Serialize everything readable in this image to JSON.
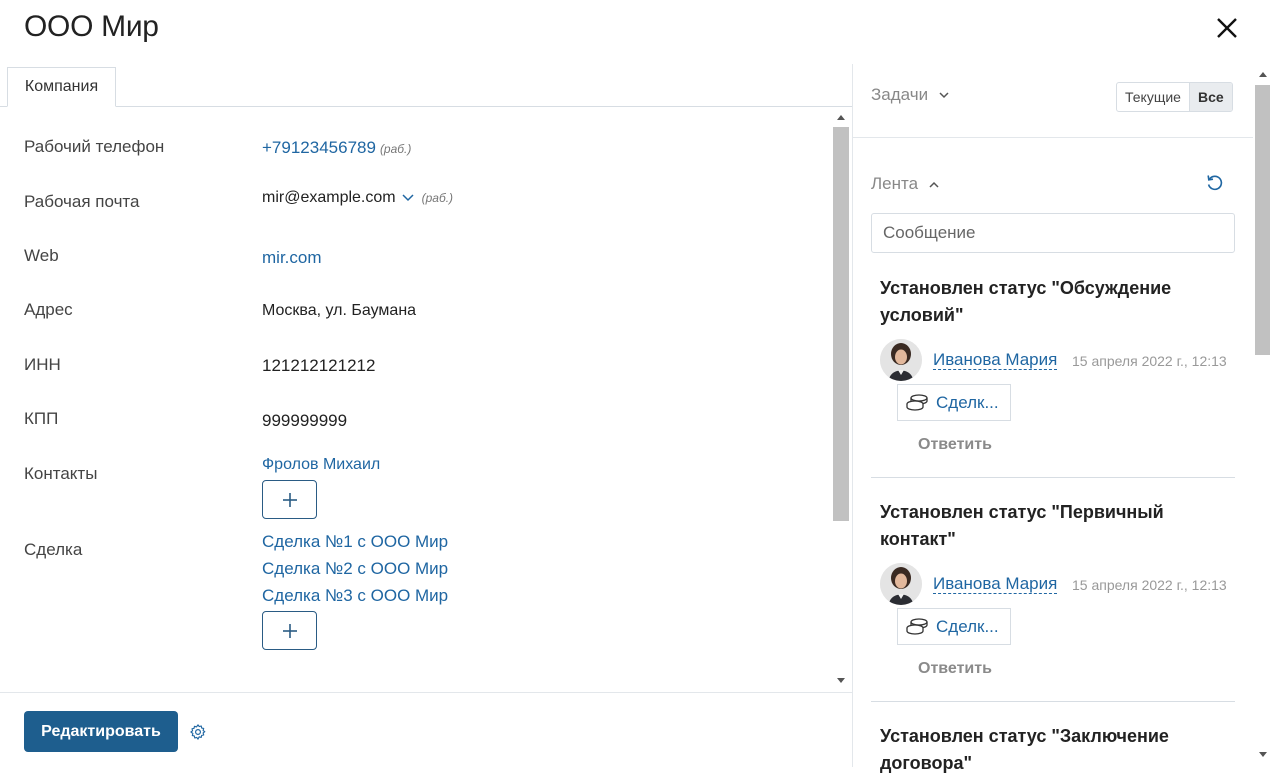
{
  "window": {
    "title": "ООО Мир"
  },
  "tabs": [
    {
      "label": "Компания"
    }
  ],
  "fields": {
    "work_phone": {
      "label": "Рабочий телефон",
      "value": "+79123456789",
      "hint": "(раб.)"
    },
    "work_email": {
      "label": "Рабочая почта",
      "value": "mir@example.com",
      "hint": "(раб.)"
    },
    "web": {
      "label": "Web",
      "value": "mir.com"
    },
    "address": {
      "label": "Адрес",
      "value": "Москва, ул. Баумана"
    },
    "inn": {
      "label": "ИНН",
      "value": "121212121212"
    },
    "kpp": {
      "label": "КПП",
      "value": "999999999"
    },
    "contacts": {
      "label": "Контакты",
      "items": [
        "Фролов Михаил"
      ]
    },
    "deals": {
      "label": "Сделка",
      "items": [
        "Сделка №1 с ООО Мир",
        "Сделка №2 с ООО Мир",
        "Сделка №3 с ООО Мир"
      ]
    }
  },
  "footer": {
    "edit_label": "Редактировать"
  },
  "tasks": {
    "title": "Задачи",
    "filters": [
      "Текущие",
      "Все"
    ],
    "active_filter": "Все"
  },
  "feed": {
    "title": "Лента",
    "message_placeholder": "Сообщение",
    "posts": [
      {
        "title": "Установлен статус \"Обсуждение условий\"",
        "author": "Иванова Мария",
        "time": "15 апреля 2022 г., 12:13",
        "attachment": "Сделк...",
        "reply_label": "Ответить"
      },
      {
        "title": "Установлен статус \"Первичный контакт\"",
        "author": "Иванова Мария",
        "time": "15 апреля 2022 г., 12:13",
        "attachment": "Сделк...",
        "reply_label": "Ответить"
      },
      {
        "title": "Установлен статус \"Заключение договора\""
      }
    ]
  },
  "icons": {
    "close": "close-icon",
    "chevron": "chevron-down-icon",
    "plus": "plus-icon",
    "gear": "gear-icon",
    "refresh": "refresh-icon",
    "coins": "coins-stack-icon"
  },
  "colors": {
    "link": "#1f66a2",
    "primary_button": "#1e5e8e",
    "muted": "#8a8a8a"
  }
}
